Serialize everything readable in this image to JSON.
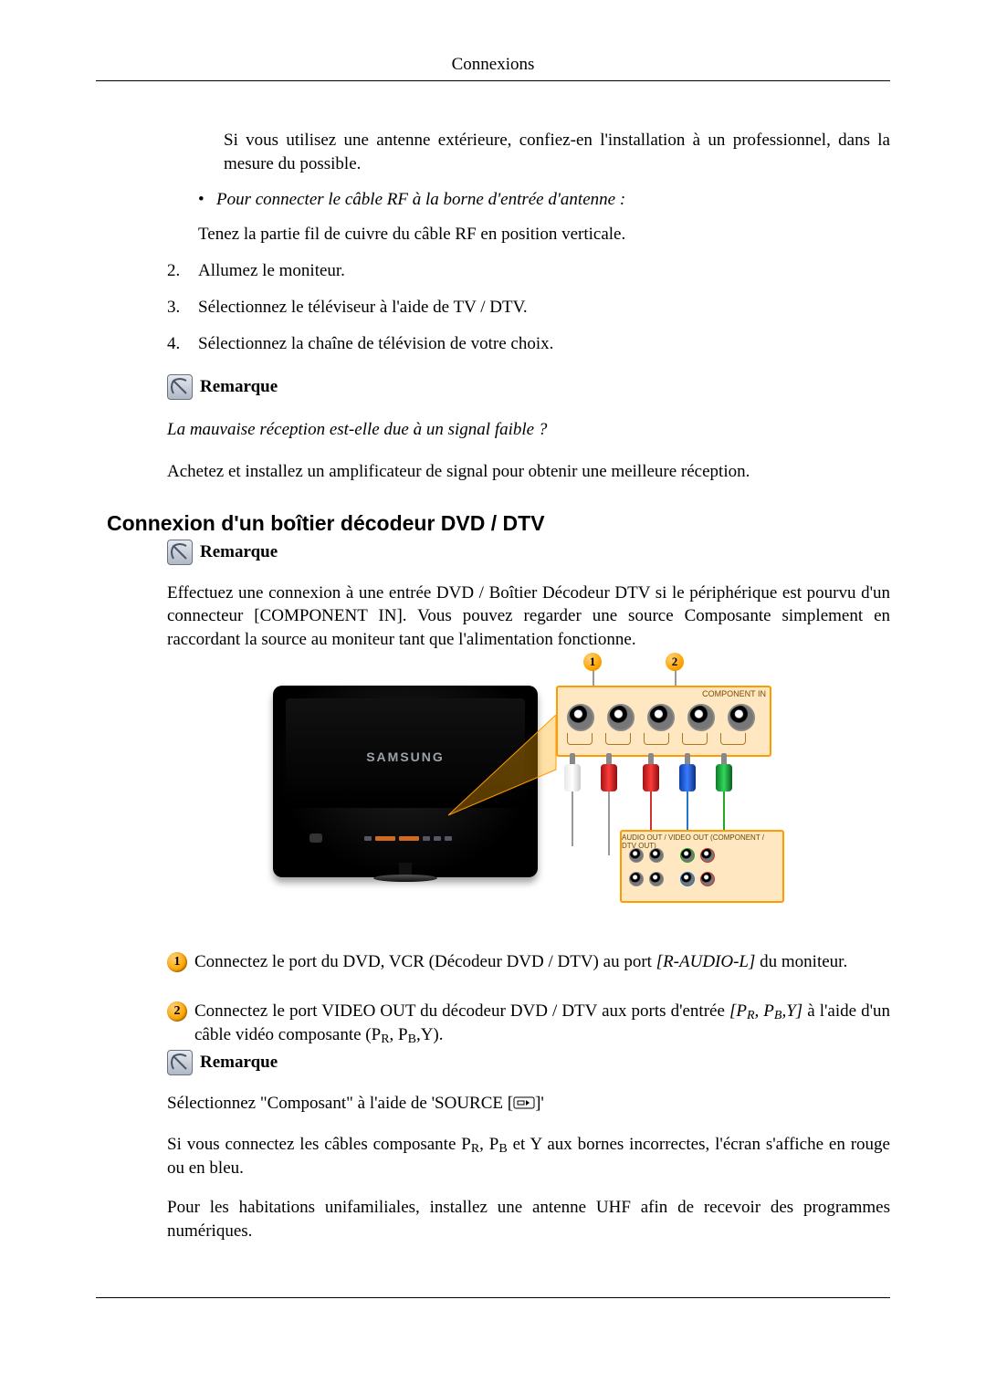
{
  "header": "Connexions",
  "intro_paragraph": "Si vous utilisez une antenne extérieure, confiez-en l'installation à un professionnel, dans la mesure du possible.",
  "rf_bullet": "Pour connecter le câble RF à la borne d'entrée d'antenne :",
  "rf_instruction": "Tenez la partie fil de cuivre du câble RF en position verticale.",
  "list": {
    "n2": "2.",
    "n3": "3.",
    "n4": "4.",
    "i2": "Allumez le moniteur.",
    "i3": "Sélectionnez le téléviseur à l'aide de TV / DTV.",
    "i4": "Sélectionnez la chaîne de télévision de votre choix."
  },
  "note_label": "Remarque",
  "weak_signal_q": "La mauvaise réception est-elle due à un signal faible ?",
  "weak_signal_a": "Achetez et installez un amplificateur de signal pour obtenir une meilleure réception.",
  "section_title": "Connexion d'un boîtier décodeur DVD / DTV",
  "section_intro": "Effectuez une connexion à une entrée DVD / Boîtier Décodeur DTV si le périphérique est pourvu d'un connecteur [COMPONENT IN]. Vous pouvez regarder une source Composante simplement en raccordant la source au moniteur tant que l'alimentation fonctionne.",
  "diagram": {
    "brand": "SAMSUNG",
    "component_in": "COMPONENT IN",
    "decoder_hdr": "AUDIO OUT / VIDEO OUT (COMPONENT / DTV OUT)",
    "badge1": "1",
    "badge2": "2"
  },
  "steps": {
    "s1_a": "Connectez le port du DVD, VCR (Décodeur DVD / DTV) au port ",
    "s1_em": "[R-AUDIO-L]",
    "s1_b": " du moniteur.",
    "s2_a": "Connectez le port VIDEO OUT du décodeur DVD / DTV aux ports d'entrée ",
    "s2_em": "[P",
    "s2_em_r": "R",
    "s2_em_mid": ", P",
    "s2_em_b": "B",
    "s2_em_end": ",Y]",
    "s2_b": " à l'aide d'un câble vidéo composante (P",
    "s2_b_r": "R",
    "s2_b_mid": ", P",
    "s2_b_b": "B",
    "s2_b_end": ",Y)."
  },
  "note3_line1_a": "Sélectionnez \"Composant\" à l'aide de 'SOURCE [",
  "note3_line1_b": "]'",
  "note3_line2_a": "Si vous connectez les câbles composante P",
  "note3_line2_r": "R",
  "note3_line2_mid": ", P",
  "note3_line2_b": "B",
  "note3_line2_end": " et Y aux bornes incorrectes, l'écran s'affiche en rouge ou en bleu.",
  "note3_line3": "Pour les habitations unifamiliales, installez une antenne UHF afin de recevoir des programmes numériques."
}
